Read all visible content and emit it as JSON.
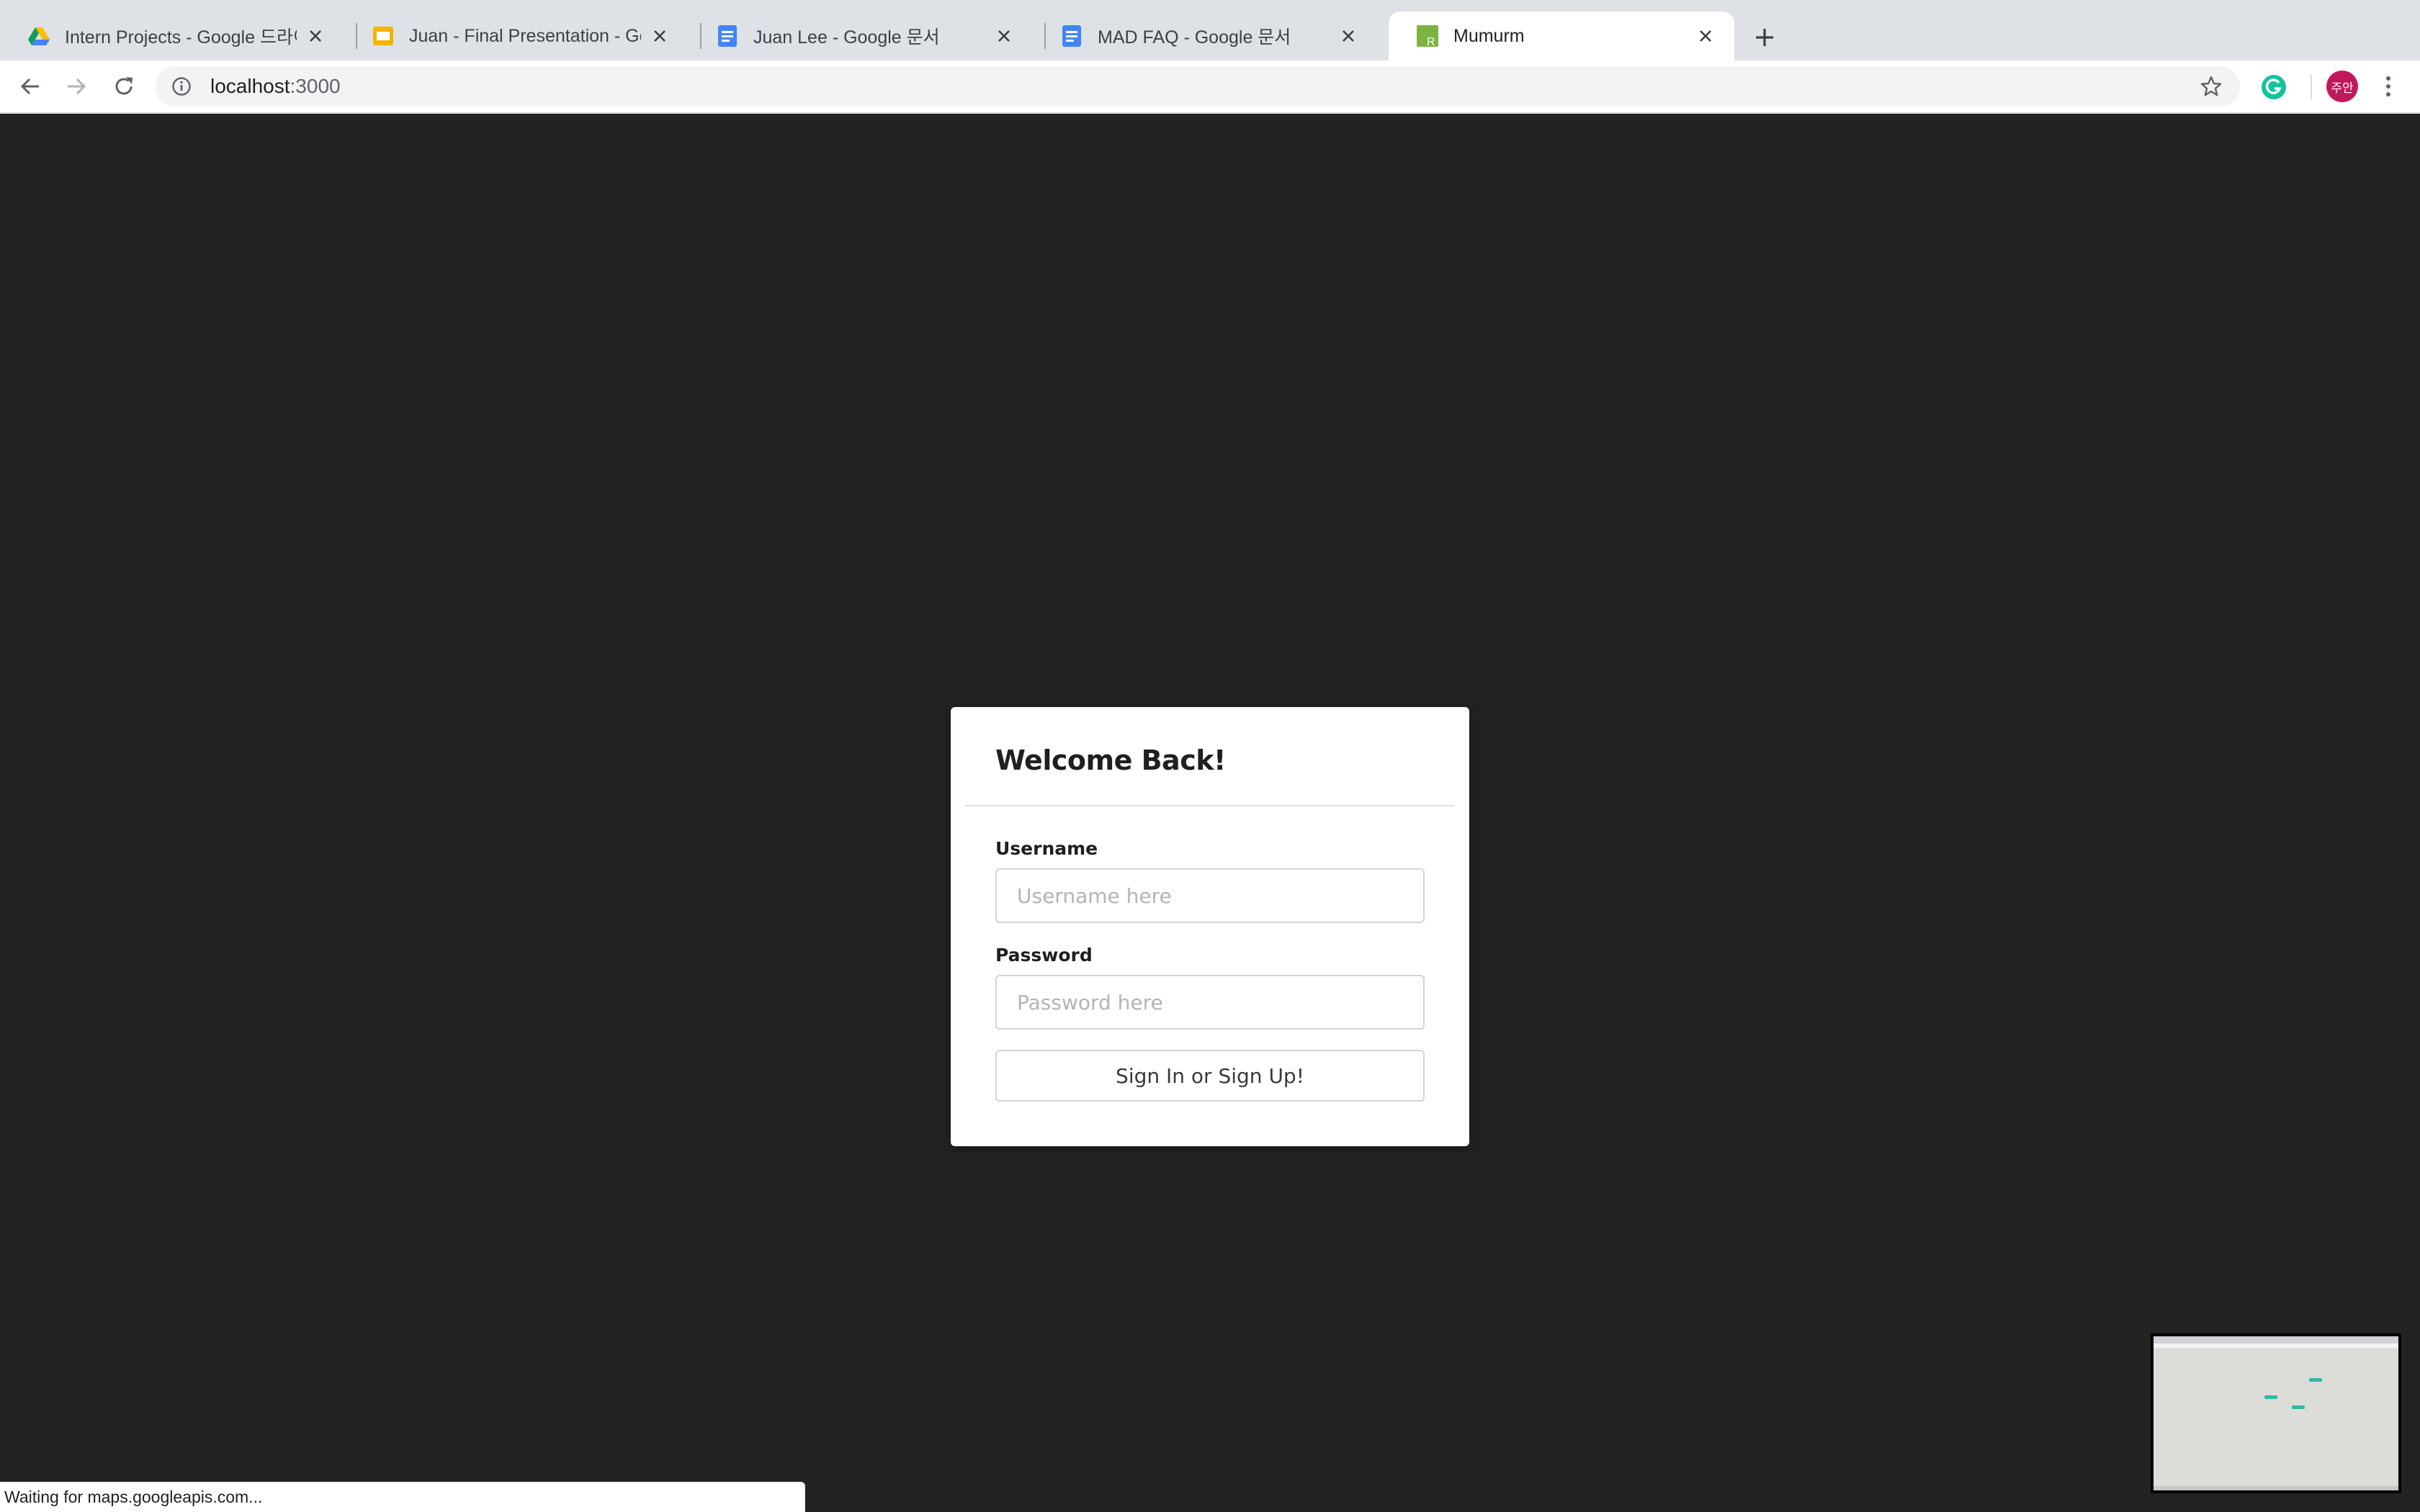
{
  "browser": {
    "tabs": [
      {
        "title": "Intern Projects - Google 드라이브",
        "icon": "google-drive-icon",
        "active": false
      },
      {
        "title": "Juan - Final Presentation - Google Slides",
        "icon": "google-slides-icon",
        "active": false
      },
      {
        "title": "Juan Lee - Google 문서",
        "icon": "google-docs-icon",
        "active": false
      },
      {
        "title": "MAD FAQ - Google 문서",
        "icon": "google-docs-icon",
        "active": false
      },
      {
        "title": "Mumurm",
        "icon": "mumurm-favicon",
        "active": true
      }
    ],
    "address": {
      "host": "localhost",
      "port": ":3000"
    },
    "profile_initials": "주안",
    "status_text": "Waiting for maps.googleapis.com..."
  },
  "login": {
    "title": "Welcome Back!",
    "username_label": "Username",
    "username_placeholder": "Username here",
    "username_value": "",
    "password_label": "Password",
    "password_placeholder": "Password here",
    "password_value": "",
    "submit_label": "Sign In or Sign Up!"
  },
  "colors": {
    "page_background": "#222220",
    "card_background": "#ffffff",
    "tabstrip_background": "#dee1e6",
    "avatar_background": "#c2185b",
    "minimap_marker": "#2eb8a8"
  }
}
